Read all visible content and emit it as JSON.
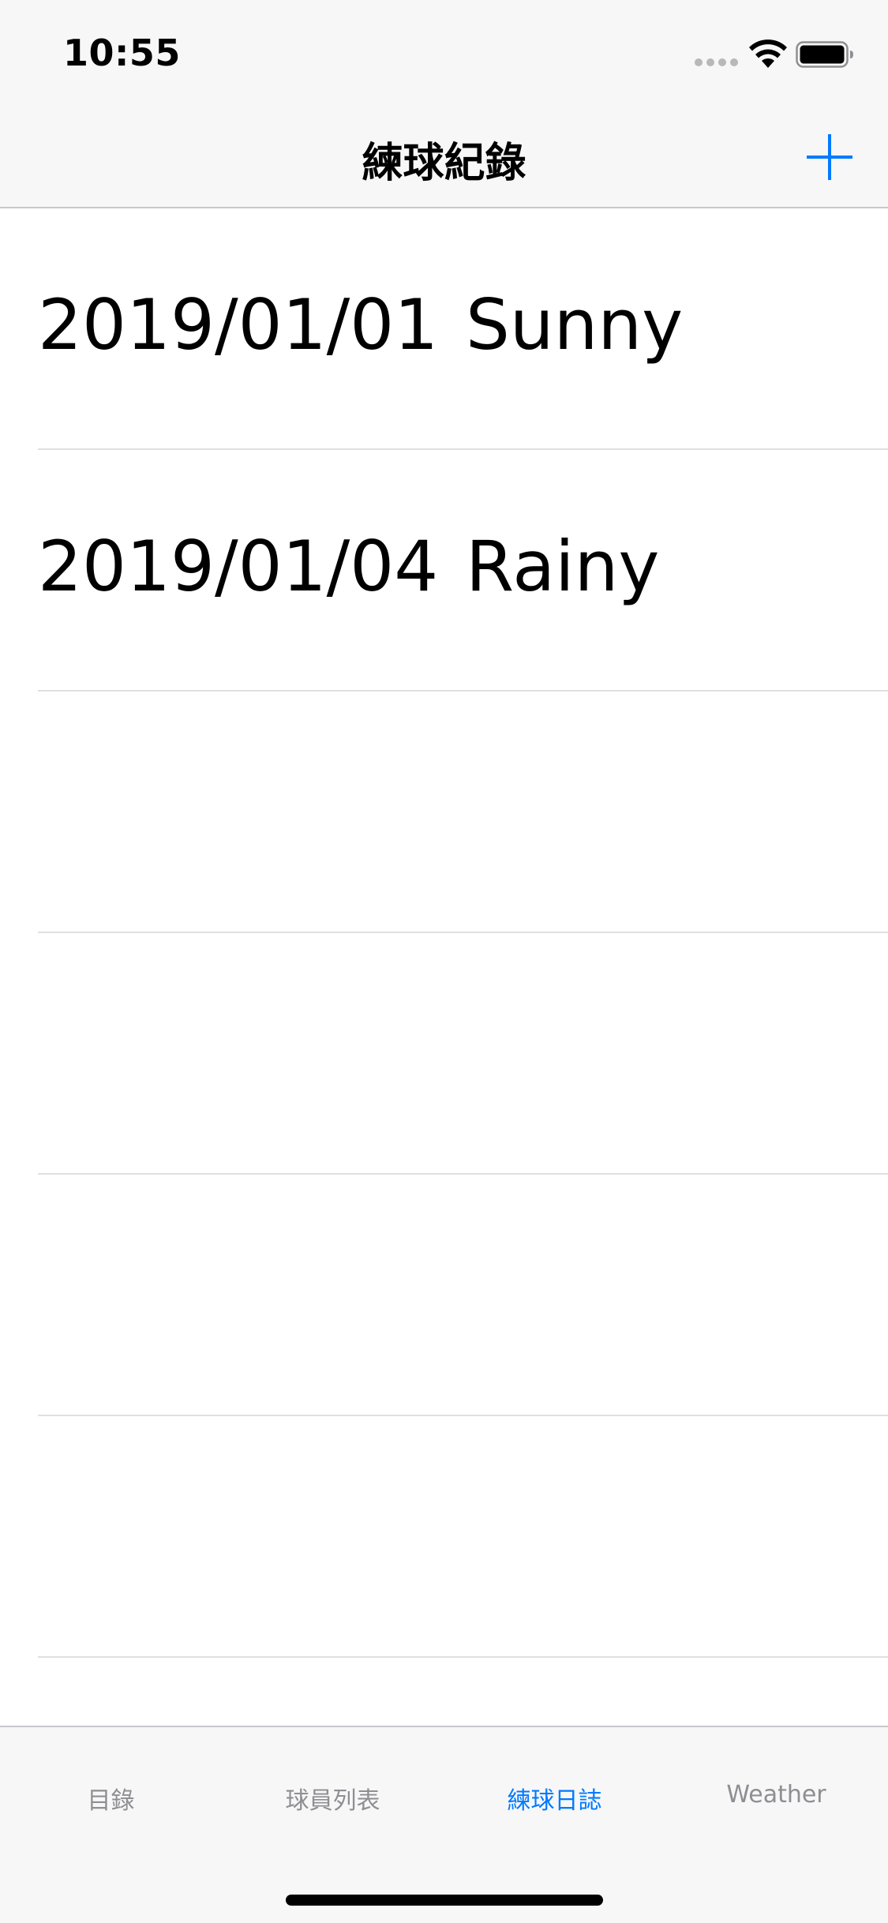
{
  "status_bar": {
    "time": "10:55"
  },
  "nav": {
    "title": "練球紀錄",
    "add_icon": "plus-icon",
    "accent_color": "#007aff"
  },
  "table": {
    "rows": [
      {
        "date": "2019/01/01",
        "weather": "Sunny"
      },
      {
        "date": "2019/01/04",
        "weather": "Rainy"
      },
      {
        "date": "",
        "weather": ""
      },
      {
        "date": "",
        "weather": ""
      },
      {
        "date": "",
        "weather": ""
      },
      {
        "date": "",
        "weather": ""
      },
      {
        "date": "",
        "weather": ""
      }
    ]
  },
  "tab_bar": {
    "tabs": [
      {
        "label": "目錄",
        "active": false
      },
      {
        "label": "球員列表",
        "active": false
      },
      {
        "label": "練球日誌",
        "active": true
      },
      {
        "label": "Weather",
        "active": false
      }
    ],
    "active_color": "#007aff",
    "inactive_color": "#8e8e93"
  }
}
